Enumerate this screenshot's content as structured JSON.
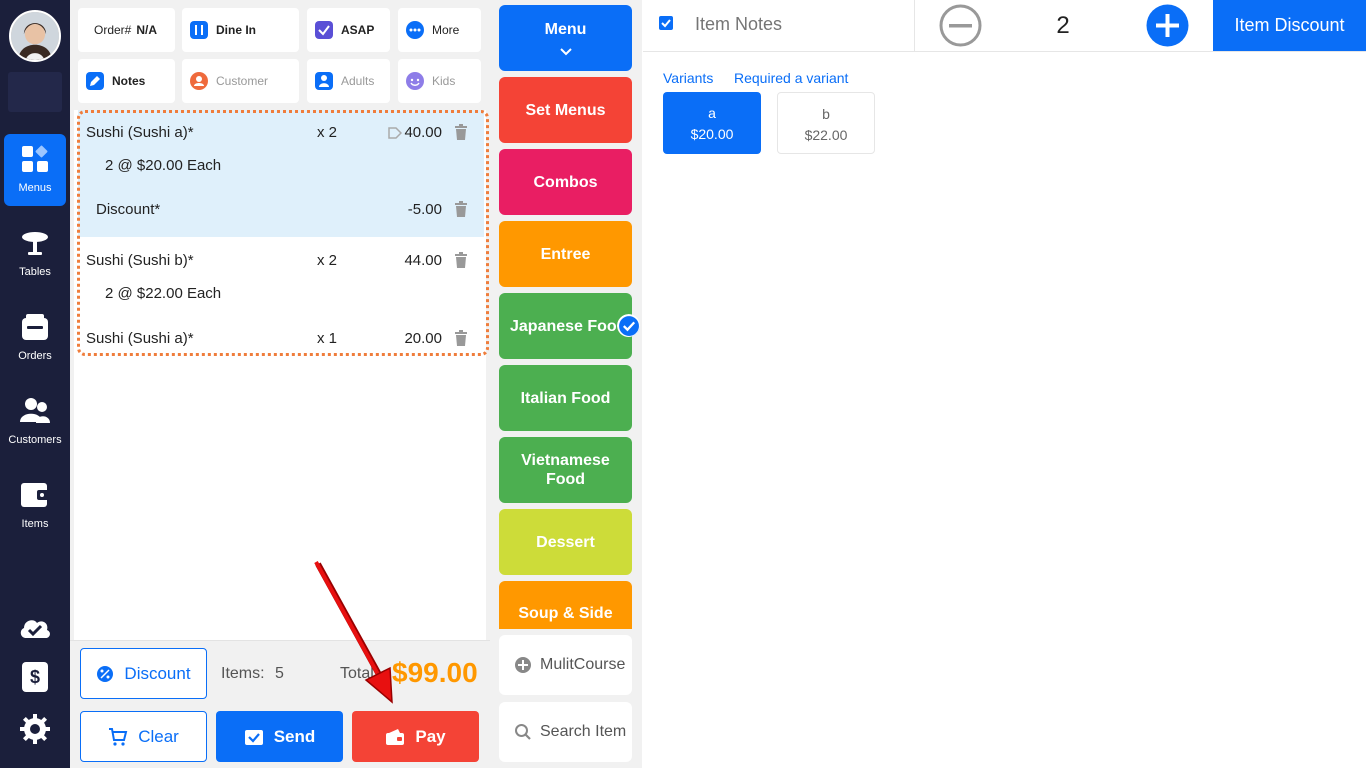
{
  "sidebar": {
    "items": [
      {
        "label": "Menus",
        "icon": "menus-icon",
        "active": true
      },
      {
        "label": "Tables",
        "icon": "table-icon"
      },
      {
        "label": "Orders",
        "icon": "orders-icon"
      },
      {
        "label": "Customers",
        "icon": "customers-icon"
      },
      {
        "label": "Items",
        "icon": "items-icon"
      }
    ],
    "bottom_icons": [
      "cloud-check-icon",
      "dollar-device-icon",
      "gear-icon"
    ]
  },
  "header_chips": {
    "order_prefix": "Order#",
    "order_value": "N/A",
    "dine_in": "Dine In",
    "asap": "ASAP",
    "more": "More",
    "notes": "Notes",
    "customer": "Customer",
    "adults": "Adults",
    "kids": "Kids"
  },
  "order_items": [
    {
      "name": "Sushi (Sushi a)*",
      "qty": "x 2",
      "amount": "40.00",
      "each": "2 @ $20.00 Each"
    },
    {
      "name": "Discount*",
      "amount": "-5.00"
    },
    {
      "name": "Sushi (Sushi b)*",
      "qty": "x 2",
      "amount": "44.00",
      "each": "2 @ $22.00 Each"
    },
    {
      "name": "Sushi (Sushi a)*",
      "qty": "x 1",
      "amount": "20.00"
    }
  ],
  "summary": {
    "discount_label": "Discount",
    "items_label": "Items:",
    "items_count": "5",
    "total_label": "Total",
    "total_value": "$99.00"
  },
  "actions": {
    "clear": "Clear",
    "send": "Send",
    "pay": "Pay"
  },
  "categories": [
    {
      "label": "Menu",
      "color": "#0a6ef7"
    },
    {
      "label": "Set Menus",
      "color": "#f44336"
    },
    {
      "label": "Combos",
      "color": "#e91e63"
    },
    {
      "label": "Entree",
      "color": "#ff9800"
    },
    {
      "label": "Japanese Food",
      "color": "#4caf50",
      "selected": true
    },
    {
      "label": "Italian Food",
      "color": "#4caf50"
    },
    {
      "label": "Vietnamese Food",
      "color": "#4caf50"
    },
    {
      "label": "Dessert",
      "color": "#cddc39"
    },
    {
      "label": "Soup & Side",
      "color": "#ff9800"
    }
  ],
  "extra_buttons": {
    "multicourse": "MulitCourse",
    "search": "Search Item"
  },
  "detail": {
    "notes_placeholder": "Item Notes",
    "quantity": "2",
    "item_discount": "Item Discount",
    "variants_label": "Variants",
    "required_label": "Required a variant",
    "variants": [
      {
        "name": "a",
        "price": "$20.00",
        "selected": true
      },
      {
        "name": "b",
        "price": "$22.00",
        "selected": false
      }
    ]
  },
  "colors": {
    "primary": "#0a6ef7",
    "danger": "#f44336",
    "total": "#ff9800",
    "sidebar": "#1b1f3b",
    "highlight": "#dff0fb",
    "dotted_border": "#ef7d3c"
  }
}
